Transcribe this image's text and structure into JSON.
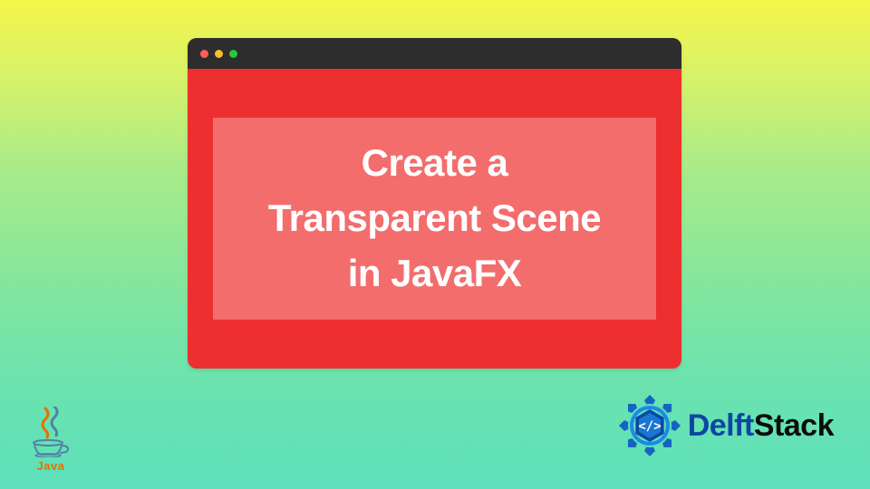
{
  "window": {
    "title_line1": "Create a",
    "title_line2": "Transparent Scene",
    "title_line3": "in JavaFX"
  },
  "java_logo": {
    "label": "Java"
  },
  "delftstack": {
    "text1": "Delft",
    "text2": "Stack"
  },
  "icons": {
    "close_dot": "close-dot",
    "minimize_dot": "minimize-dot",
    "maximize_dot": "maximize-dot"
  }
}
